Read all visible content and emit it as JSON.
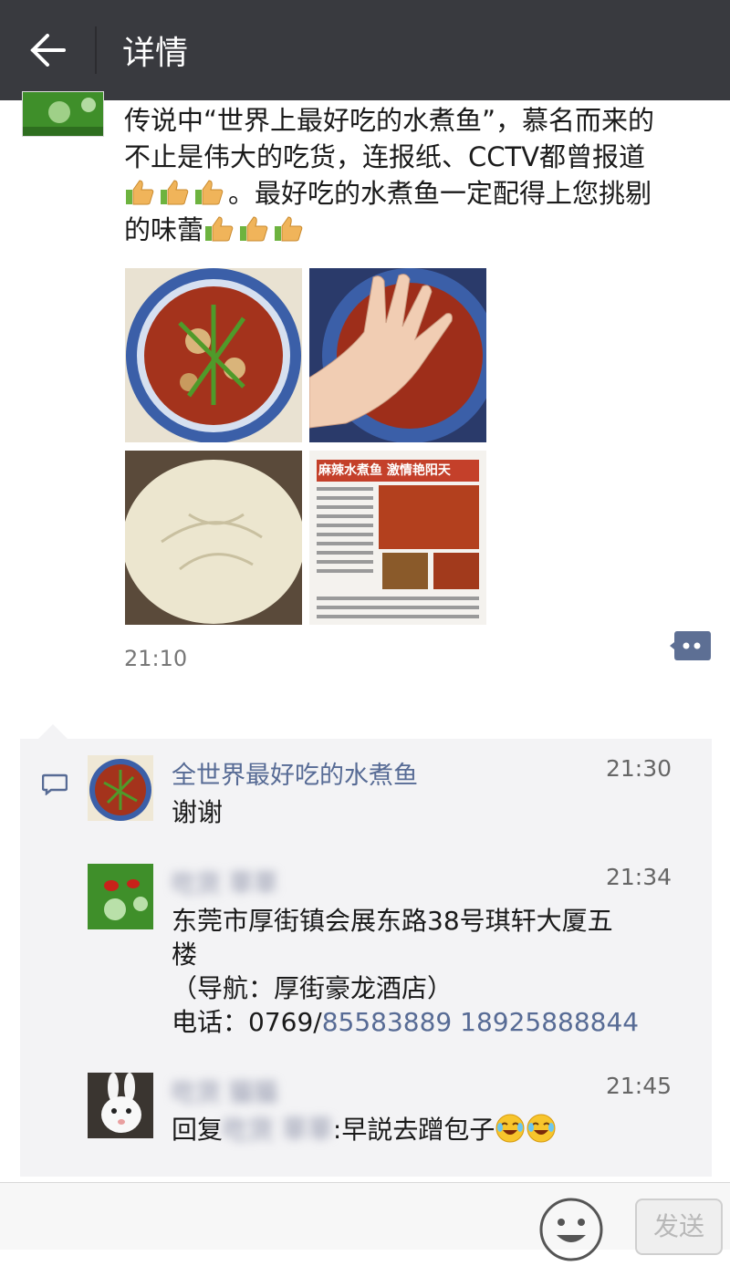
{
  "header": {
    "title": "详情"
  },
  "post": {
    "text_line1": "传说中“世界上最好吃的水煮鱼”，慕名而来的",
    "text_line2": "不止是伟大的吃货，连报纸、CCTV都曾报道",
    "text_line3": "。最好吃的水煮鱼一定配得上您挑剔",
    "text_line4": "的味蕾",
    "time": "21:10",
    "newspaper_headline": "麻辣水煮鱼 激情艳阳天"
  },
  "comments": [
    {
      "name": "全世界最好吃的水煮鱼",
      "time": "21:30",
      "text": "谢谢"
    },
    {
      "name": "吃货 草草",
      "time": "21:34",
      "line1": "东莞市厚街镇会展东路38号琪轩大厦五",
      "line2": "楼",
      "line3": "（导航：厚街豪龙酒店）",
      "phone_prefix": "电话：0769/",
      "phone1": "85583889",
      "phone2": "18925888844"
    },
    {
      "name": "吃货 猫猫",
      "time": "21:45",
      "reply_prefix": "回复",
      "reply_name": "吃货 草草",
      "reply_text": ":早説去蹭包子"
    }
  ],
  "input": {
    "send_label": "发送"
  },
  "colors": {
    "topbar": "#393a3f",
    "link": "#576b95",
    "comment_bg": "#f3f3f5"
  }
}
